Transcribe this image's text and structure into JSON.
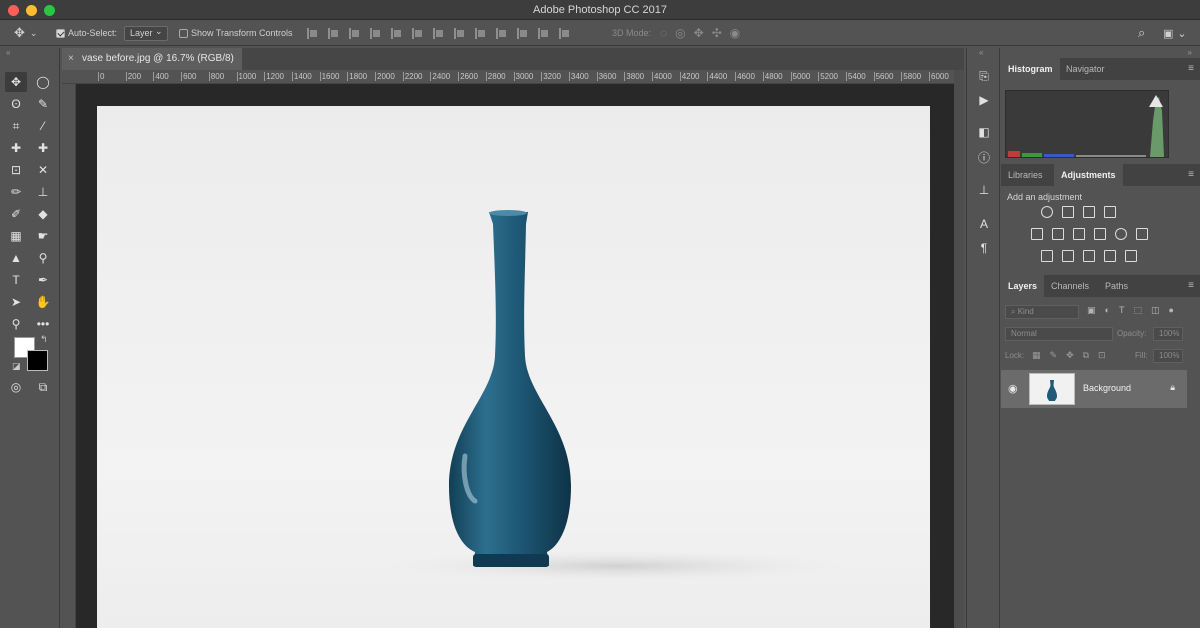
{
  "window": {
    "app_title": "Adobe Photoshop CC 2017"
  },
  "options_bar": {
    "auto_select_label": "Auto-Select:",
    "auto_select_checked": true,
    "auto_select_target": "Layer",
    "show_transform_label": "Show Transform Controls",
    "mode_3d_label": "3D Mode:"
  },
  "document_tab": {
    "title": "vase before.jpg @ 16.7% (RGB/8)",
    "close_glyph": "×"
  },
  "ruler": {
    "top_ticks": [
      "0",
      "200",
      "400",
      "600",
      "800",
      "1000",
      "1200",
      "1400",
      "1600",
      "1800",
      "2000",
      "2200",
      "2400",
      "2600",
      "2800",
      "3000",
      "3200",
      "3400",
      "3600",
      "3800",
      "4000",
      "4200",
      "4400",
      "4600",
      "4800",
      "5000",
      "5200",
      "5400",
      "5600",
      "5800",
      "6000"
    ]
  },
  "panels": {
    "histogram": {
      "tabs": [
        "Histogram",
        "Navigator"
      ],
      "active": "Histogram"
    },
    "adjustments": {
      "tabs": [
        "Libraries",
        "Adjustments"
      ],
      "active": "Adjustments",
      "add_label": "Add an adjustment"
    },
    "layers": {
      "tabs": [
        "Layers",
        "Channels",
        "Paths"
      ],
      "active": "Layers",
      "kind_placeholder": "Kind",
      "blend_mode": "Normal",
      "opacity_label": "Opacity:",
      "opacity_value": "100%",
      "lock_label": "Lock:",
      "fill_label": "Fill:",
      "fill_value": "100%",
      "items": [
        {
          "name": "Background",
          "visible": true,
          "locked": true
        }
      ]
    }
  },
  "colors": {
    "foreground": "#ffffff",
    "background": "#000000",
    "vase": "#1f5a78"
  }
}
